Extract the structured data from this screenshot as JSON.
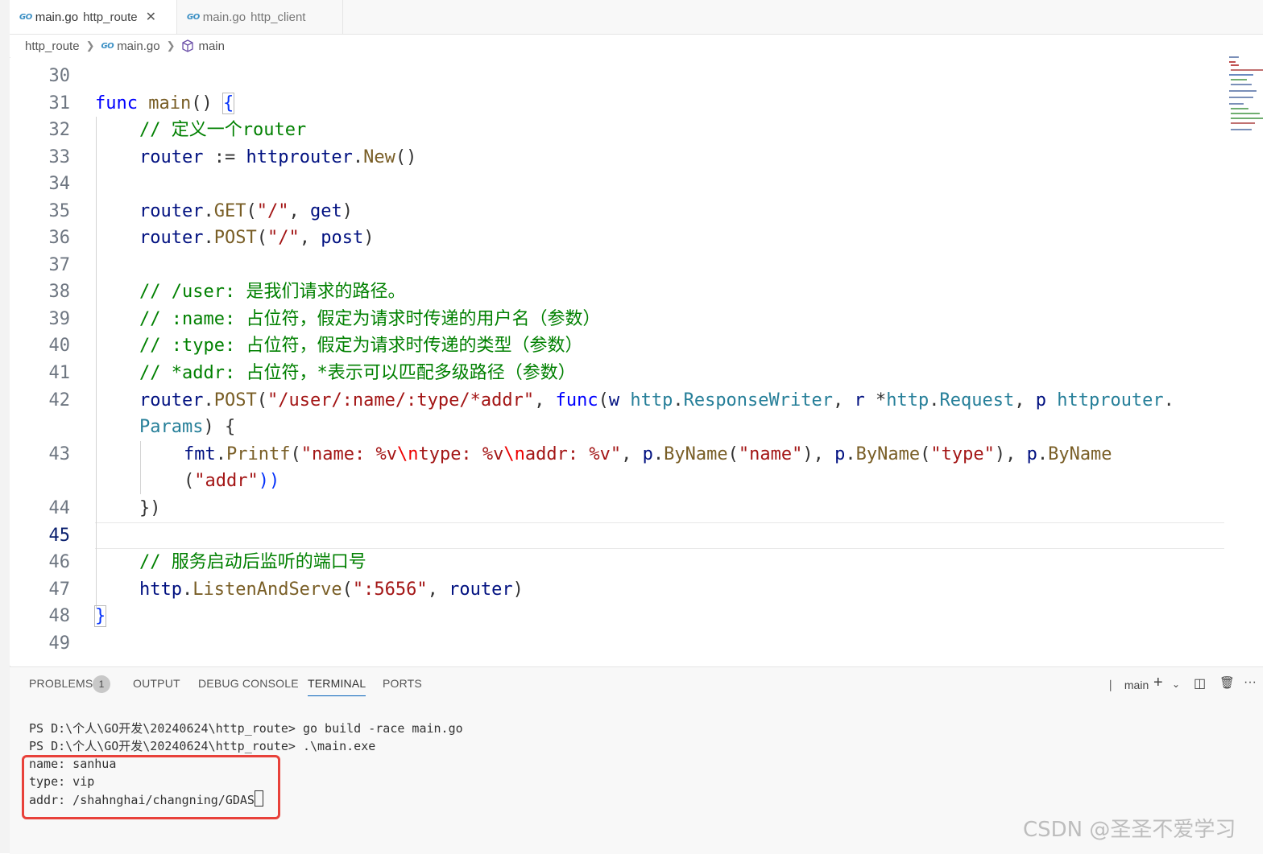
{
  "tabs": [
    {
      "icon": "go-icon",
      "file": "main.go",
      "folder": "http_route",
      "active": true,
      "close": "✕"
    },
    {
      "icon": "go-icon",
      "file": "main.go",
      "folder": "http_client",
      "active": false
    }
  ],
  "go_badge": "GO",
  "breadcrumb": {
    "folder": "http_route",
    "file": "main.go",
    "symbol": "main"
  },
  "editor": {
    "line_numbers": [
      "30",
      "31",
      "32",
      "33",
      "34",
      "35",
      "36",
      "37",
      "38",
      "39",
      "40",
      "41",
      "42",
      "43",
      "44",
      "45",
      "46",
      "47",
      "48",
      "49"
    ],
    "code": {
      "l31": [
        "func",
        " ",
        "main",
        "()",
        " ",
        "{"
      ],
      "l32": "// 定义一个router",
      "l33": [
        "router",
        " := ",
        "httprouter",
        ".",
        "New",
        "()"
      ],
      "l35": [
        "router",
        ".",
        "GET",
        "(",
        "\"/\"",
        ", ",
        "get",
        ")"
      ],
      "l36": [
        "router",
        ".",
        "POST",
        "(",
        "\"/\"",
        ", ",
        "post",
        ")"
      ],
      "l38": "// /user: 是我们请求的路径。",
      "l39": "// :name: 占位符，假定为请求时传递的用户名（参数）",
      "l40": "// :type: 占位符，假定为请求时传递的类型（参数）",
      "l41": "// *addr: 占位符，*表示可以匹配多级路径（参数）",
      "l42a": [
        "router",
        ".",
        "POST",
        "(",
        "\"/user/:name/:type/*addr\"",
        ", ",
        "func",
        "(",
        "w",
        " ",
        "http",
        ".",
        "ResponseWriter",
        ", ",
        "r",
        " *",
        "http",
        ".",
        "Request",
        ", ",
        "p",
        " ",
        "httprouter",
        "."
      ],
      "l42b": [
        "Params",
        ")",
        " {"
      ],
      "l43a": [
        "fmt",
        ".",
        "Printf",
        "(",
        "\"name: %v",
        "\\n",
        "type: %v",
        "\\n",
        "addr: %v\"",
        ", ",
        "p",
        ".",
        "ByName",
        "(",
        "\"name\"",
        "), ",
        "p",
        ".",
        "ByName",
        "(",
        "\"type\"",
        "), ",
        "p",
        ".",
        "ByName"
      ],
      "l43b": [
        "(",
        "\"addr\"",
        "))"
      ],
      "l44": "})",
      "l46": "// 服务启动后监听的端口号",
      "l47": [
        "http",
        ".",
        "ListenAndServe",
        "(",
        "\":5656\"",
        ", ",
        "router",
        ")"
      ],
      "l48": "}"
    }
  },
  "panel": {
    "tabs": [
      "PROBLEMS",
      "OUTPUT",
      "DEBUG CONSOLE",
      "TERMINAL",
      "PORTS"
    ],
    "problems_count": "1",
    "terminal_name": "main",
    "actions": {
      "add": "+",
      "dropdown": "⌄",
      "split": "◫",
      "trash": "🗑",
      "more": "···"
    },
    "terminal_lines": [
      "PS D:\\个人\\GO开发\\20240624\\http_route> go build -race main.go",
      "PS D:\\个人\\GO开发\\20240624\\http_route> .\\main.exe",
      "name: sanhua",
      "type: vip",
      "addr: /shahnghai/changning/GDAS"
    ]
  },
  "watermark": "CSDN @圣圣不爱学习"
}
